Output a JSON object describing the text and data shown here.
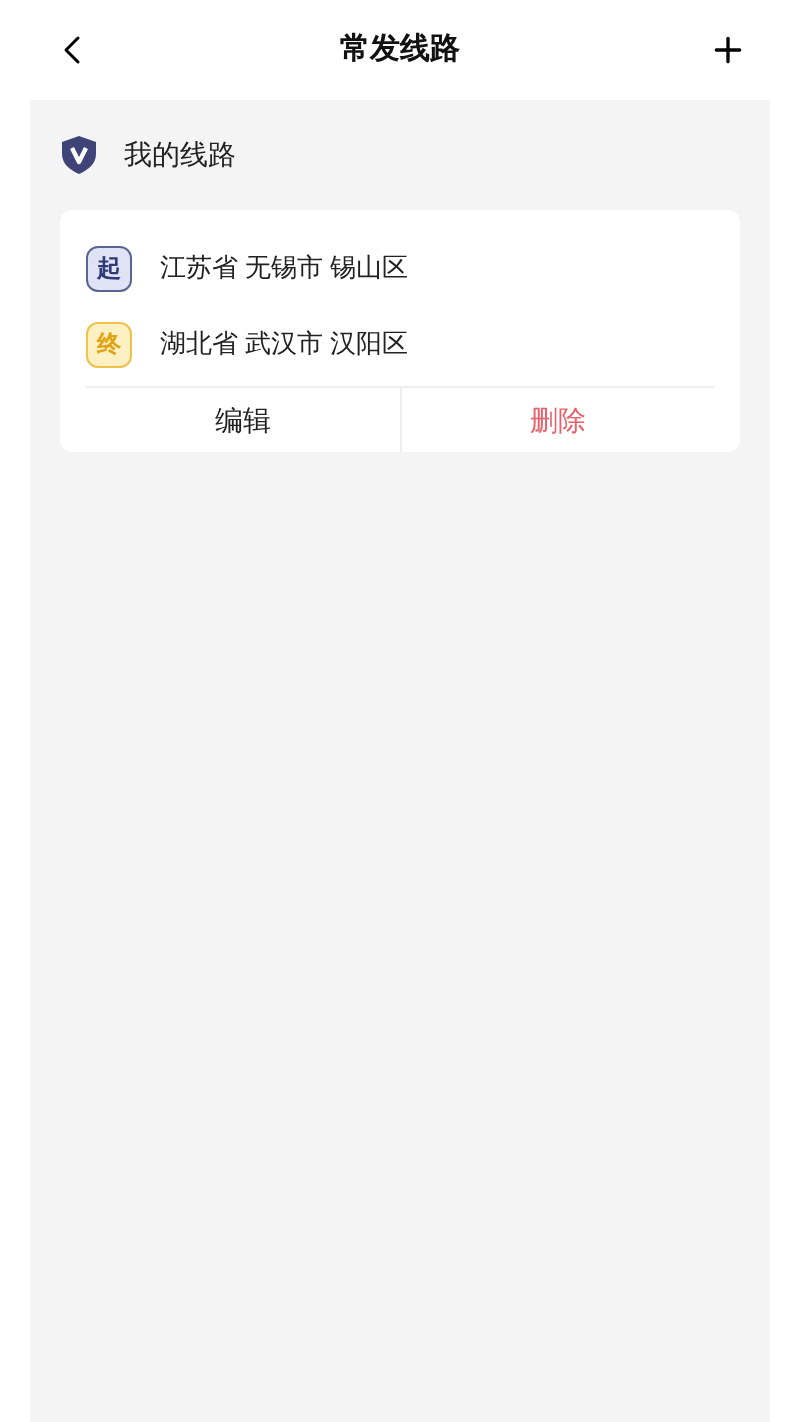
{
  "header": {
    "title": "常发线路"
  },
  "section": {
    "title": "我的线路"
  },
  "routes": [
    {
      "stops": [
        {
          "kind": "start",
          "marker": "起",
          "place": "江苏省 无锡市 锡山区"
        },
        {
          "kind": "end",
          "marker": "终",
          "place": "湖北省 武汉市 汉阳区"
        }
      ],
      "actions": [
        {
          "kind": "edit",
          "label": "编辑"
        },
        {
          "kind": "delete",
          "label": "删除"
        }
      ]
    }
  ]
}
